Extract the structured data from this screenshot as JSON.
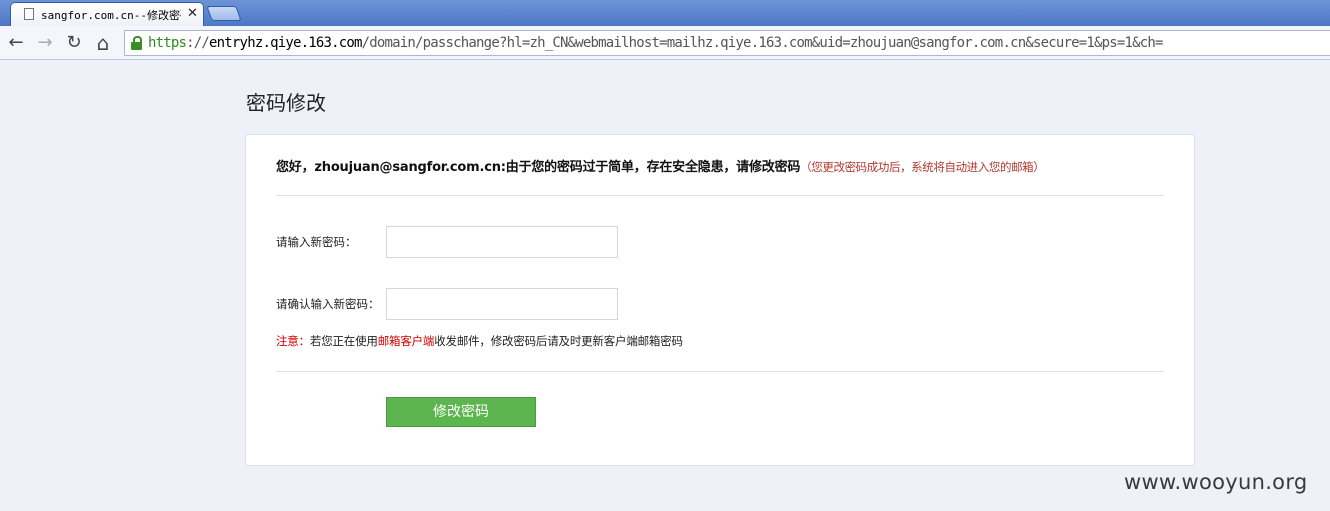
{
  "browser": {
    "tab_title": "sangfor.com.cn--修改密码",
    "tab_close": "✕",
    "url_scheme": "https",
    "url_sep": "://",
    "url_host": "entryhz.qiye.163.com",
    "url_path": "/domain/passchange?hl=zh_CN&webmailhost=mailhz.qiye.163.com&uid=zhoujuan@sangfor.com.cn&secure=1&ps=1&ch=",
    "back_glyph": "←",
    "forward_glyph": "→",
    "reload_glyph": "↻",
    "home_glyph": "⌂"
  },
  "page": {
    "title": "密码修改",
    "greeting": "您好，zhoujuan@sangfor.com.cn:由于您的密码过于简单，存在安全隐患，请修改密码",
    "greeting_note": "（您更改密码成功后，系统将自动进入您的邮箱）",
    "new_password_label": "请输入新密码：",
    "confirm_password_label": "请确认输入新密码：",
    "new_password_value": "",
    "confirm_password_value": "",
    "notice_prefix": "注意：",
    "notice_part1": "若您正在使用",
    "notice_highlight": "邮箱客户端",
    "notice_part2": "收发邮件，修改密码后请及时更新客户端邮箱密码",
    "submit_label": "修改密码"
  },
  "watermark": "www.wooyun.org"
}
